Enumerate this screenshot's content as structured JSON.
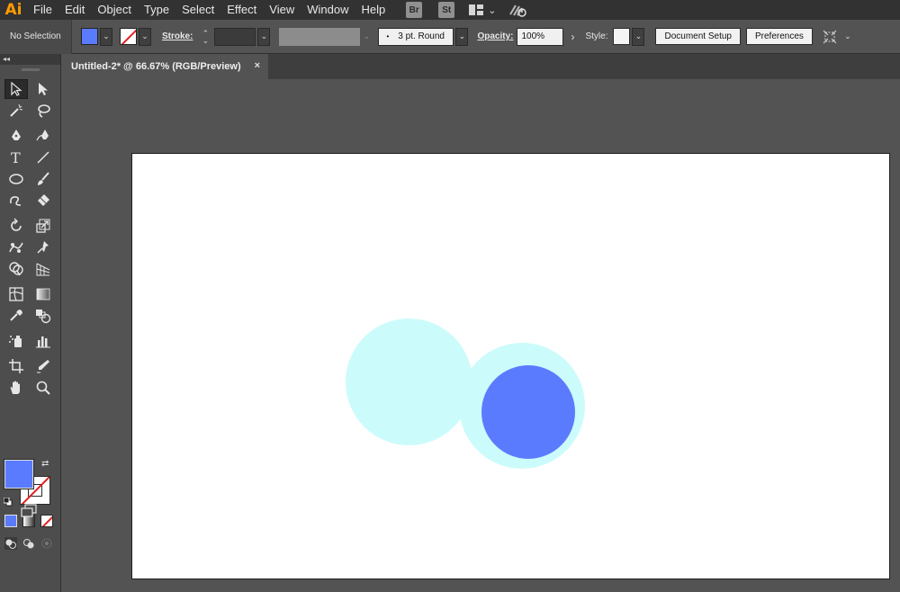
{
  "app": {
    "logo": "Ai"
  },
  "menu": [
    "File",
    "Edit",
    "Object",
    "Type",
    "Select",
    "Effect",
    "View",
    "Window",
    "Help"
  ],
  "menu_extras": {
    "bridge": "Br",
    "stock": "St"
  },
  "control": {
    "selection_status": "No Selection",
    "stroke_label": "Stroke:",
    "brush_dot": "•",
    "brush_value": "3 pt. Round",
    "opacity_label": "Opacity:",
    "opacity_value": "100%",
    "style_label": "Style:",
    "document_setup": "Document Setup",
    "preferences": "Preferences"
  },
  "document_tab": {
    "title": "Untitled-2* @ 66.67% (RGB/Preview)",
    "close": "×"
  },
  "colors": {
    "fill": "#5b7bff",
    "stroke": "none",
    "light_circle": "#ccfbfb",
    "dark_circle": "#5b7bff",
    "artboard": "#ffffff"
  },
  "tools": [
    "selection-tool",
    "direct-selection-tool",
    "magic-wand-tool",
    "lasso-tool",
    "pen-tool",
    "curvature-tool",
    "type-tool",
    "line-segment-tool",
    "ellipse-tool",
    "paintbrush-tool",
    "shaper-tool",
    "eraser-tool",
    "rotate-tool",
    "scale-tool",
    "puppet-warp-tool",
    "width-tool",
    "shape-builder-tool",
    "perspective-grid-tool",
    "mesh-tool",
    "gradient-tool",
    "eyedropper-tool",
    "blend-tool",
    "symbol-sprayer-tool",
    "column-graph-tool",
    "artboard-tool",
    "slice-tool",
    "hand-tool",
    "zoom-tool"
  ]
}
